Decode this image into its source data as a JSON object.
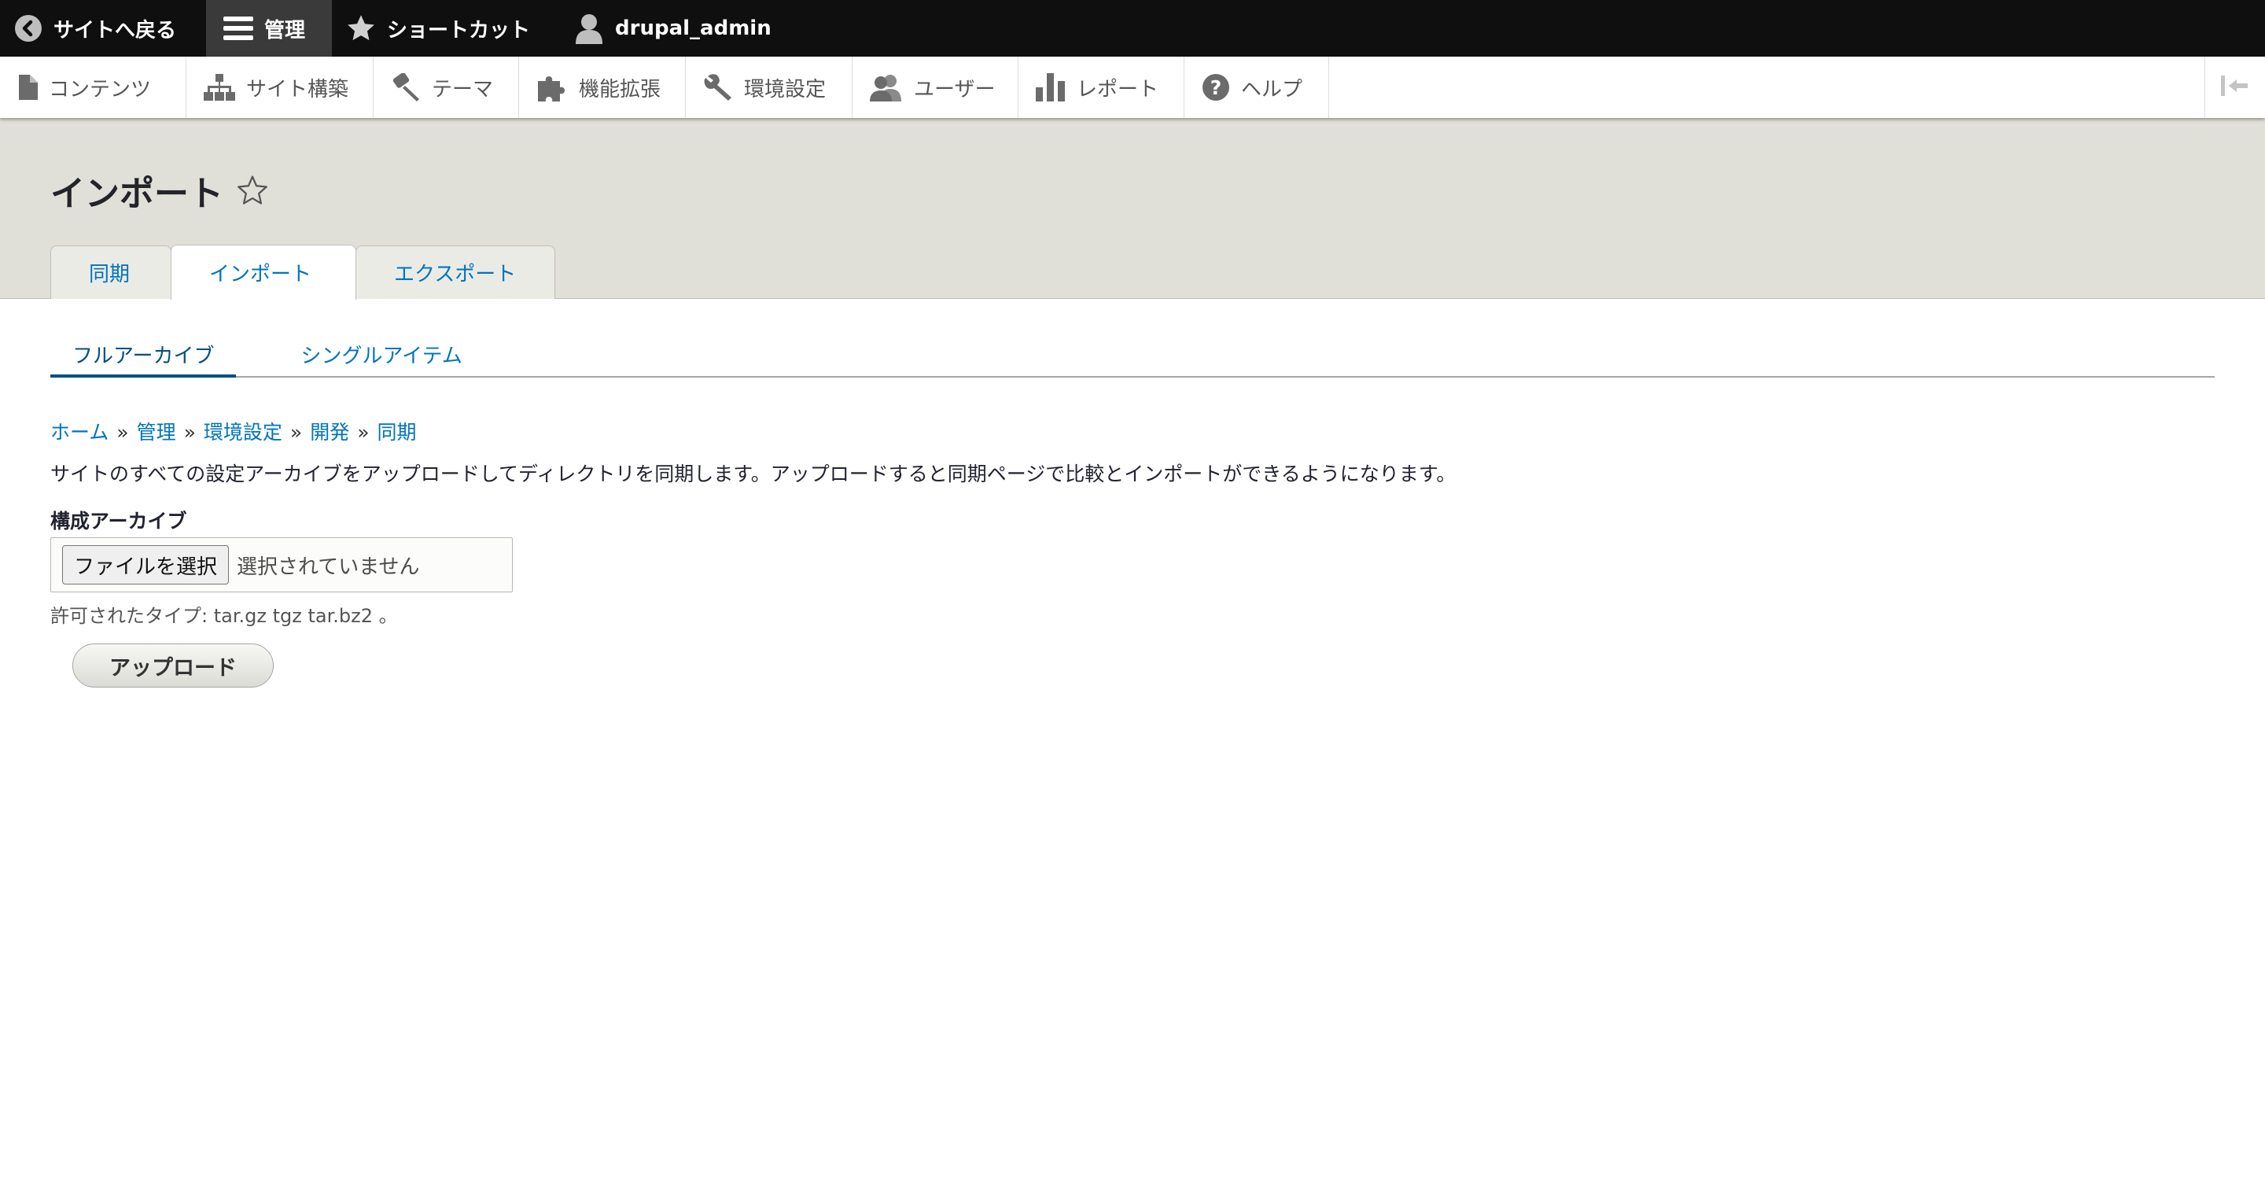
{
  "toolbar": {
    "back_label": "サイトへ戻る",
    "manage_label": "管理",
    "shortcuts_label": "ショートカット",
    "user_label": "drupal_admin"
  },
  "tray": {
    "items": [
      {
        "label": "コンテンツ",
        "icon": "file-icon"
      },
      {
        "label": "サイト構築",
        "icon": "sitemap-icon"
      },
      {
        "label": "テーマ",
        "icon": "paintbrush-icon"
      },
      {
        "label": "機能拡張",
        "icon": "puzzle-icon"
      },
      {
        "label": "環境設定",
        "icon": "wrench-icon"
      },
      {
        "label": "ユーザー",
        "icon": "users-icon"
      },
      {
        "label": "レポート",
        "icon": "bar-chart-icon"
      },
      {
        "label": "ヘルプ",
        "icon": "help-icon"
      }
    ]
  },
  "header": {
    "title": "インポート",
    "tabs": [
      {
        "label": "同期"
      },
      {
        "label": "インポート",
        "active": true
      },
      {
        "label": "エクスポート"
      }
    ]
  },
  "subtabs": [
    {
      "label": "フルアーカイブ",
      "active": true
    },
    {
      "label": "シングルアイテム"
    }
  ],
  "breadcrumb": {
    "items": [
      "ホーム",
      "管理",
      "環境設定",
      "開発",
      "同期"
    ],
    "separator": "»"
  },
  "content": {
    "description": "サイトのすべての設定アーカイブをアップロードしてディレクトリを同期します。アップロードすると同期ページで比較とインポートができるようになります。",
    "field_label": "構成アーカイブ",
    "file_button_label": "ファイルを選択",
    "file_status": "選択されていません",
    "help_text": "許可されたタイプ: tar.gz tgz tar.bz2 。",
    "upload_button_label": "アップロード"
  },
  "colors": {
    "toolbar_bg": "#0f0f0f",
    "header_bg": "#e0e0d8",
    "link": "#0074bd"
  }
}
